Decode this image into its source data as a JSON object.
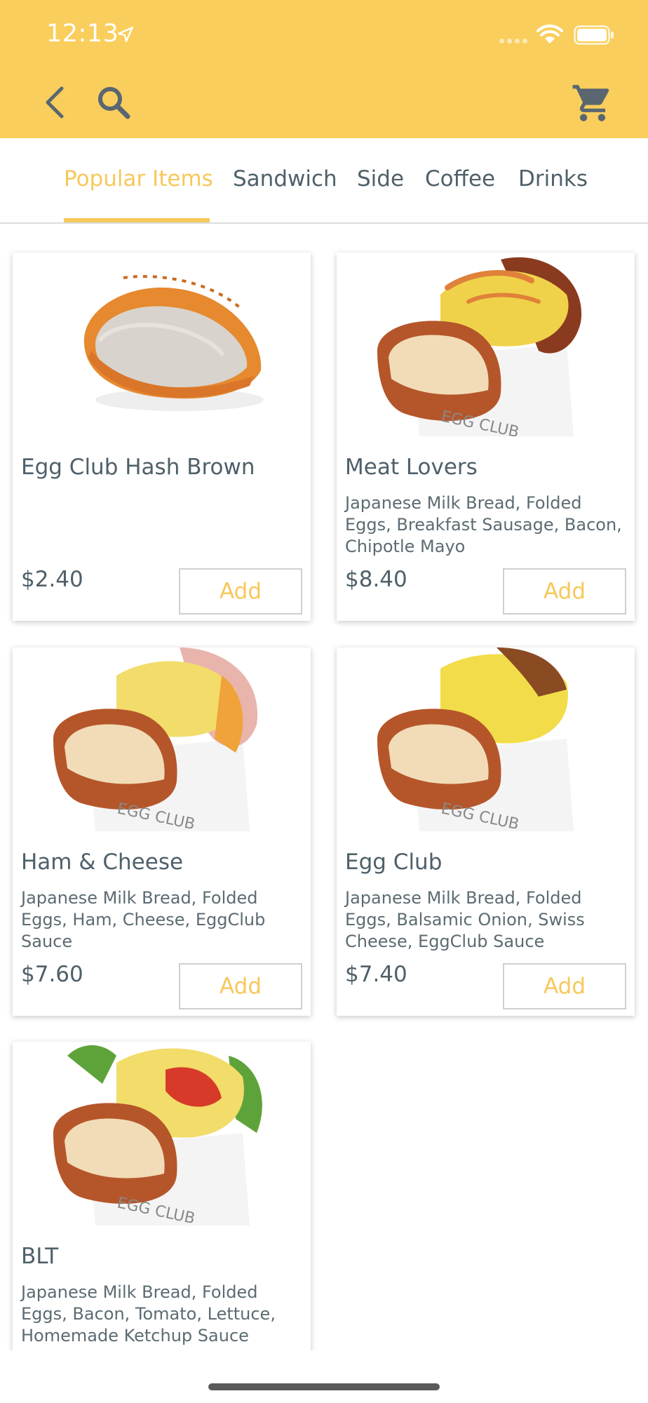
{
  "status_bar": {
    "time": "12:13"
  },
  "colors": {
    "header_bg": "#f9ce5c",
    "accent": "#f7c85a",
    "text": "#4f6069"
  },
  "header": {
    "icons": [
      "back-icon",
      "search-icon",
      "cart-icon"
    ]
  },
  "tabs": [
    {
      "label": "Popular Items",
      "active": true
    },
    {
      "label": "Sandwich",
      "active": false
    },
    {
      "label": "Side",
      "active": false
    },
    {
      "label": "Coffee",
      "active": false
    },
    {
      "label": "Drinks",
      "active": false
    }
  ],
  "products": [
    {
      "name": "Egg Club Hash Brown",
      "description": "",
      "price": "$2.40",
      "add_label": "Add",
      "image": "hash-brown-photo"
    },
    {
      "name": "Meat Lovers",
      "description": "Japanese Milk Bread, Folded Eggs, Breakfast Sausage, Bacon, Chipotle Mayo",
      "price": "$8.40",
      "add_label": "Add",
      "image": "meat-lovers-sandwich-photo"
    },
    {
      "name": "Ham & Cheese",
      "description": "Japanese Milk Bread, Folded Eggs, Ham, Cheese, EggClub Sauce",
      "price": "$7.60",
      "add_label": "Add",
      "image": "ham-cheese-sandwich-photo"
    },
    {
      "name": "Egg Club",
      "description": "Japanese Milk Bread, Folded Eggs, Balsamic Onion, Swiss Cheese, EggClub Sauce",
      "price": "$7.40",
      "add_label": "Add",
      "image": "egg-club-sandwich-photo"
    },
    {
      "name": "BLT",
      "description": "Japanese Milk Bread, Folded Eggs, Bacon, Tomato, Lettuce, Homemade Ketchup Sauce",
      "price": "",
      "add_label": "",
      "image": "blt-sandwich-photo"
    }
  ],
  "box_label": "EGG CLUB"
}
